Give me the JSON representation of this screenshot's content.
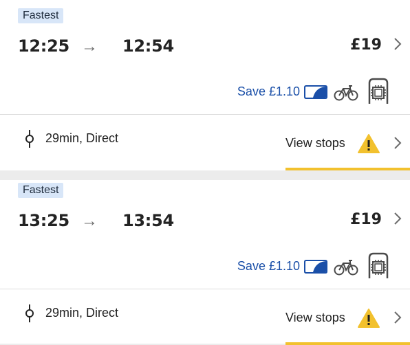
{
  "journeys": [
    {
      "tag": "Fastest",
      "depart": "12:25",
      "arrow": "→",
      "arrive": "12:54",
      "price": "£19",
      "save": "Save £1.10",
      "duration": "29min, Direct",
      "view_stops": "View stops"
    },
    {
      "tag": "Fastest",
      "depart": "13:25",
      "arrow": "→",
      "arrive": "13:54",
      "price": "£19",
      "save": "Save £1.10",
      "duration": "29min, Direct",
      "view_stops": "View stops"
    }
  ],
  "icons": {
    "railcard": "railcard-icon",
    "bike": "bicycle-icon",
    "seat": "seat-reservation-icon",
    "warning": "warning-icon",
    "stop": "stop-marker-icon",
    "chevron": "chevron-right-icon"
  },
  "colors": {
    "accent_blue": "#1a4fa8",
    "tag_bg": "#d8e6f8",
    "warning_yellow": "#f2c12e"
  }
}
